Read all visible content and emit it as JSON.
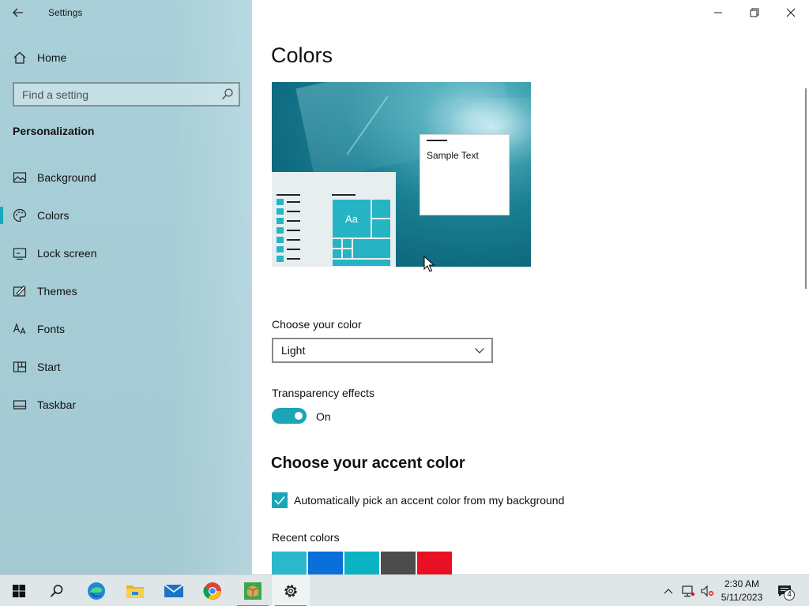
{
  "window": {
    "title": "Settings"
  },
  "sidebar": {
    "home_label": "Home",
    "search_placeholder": "Find a setting",
    "section_title": "Personalization",
    "items": [
      {
        "label": "Background",
        "icon": "image-icon"
      },
      {
        "label": "Colors",
        "icon": "palette-icon",
        "active": true
      },
      {
        "label": "Lock screen",
        "icon": "lock-screen-icon"
      },
      {
        "label": "Themes",
        "icon": "themes-icon"
      },
      {
        "label": "Fonts",
        "icon": "fonts-icon"
      },
      {
        "label": "Start",
        "icon": "start-icon"
      },
      {
        "label": "Taskbar",
        "icon": "taskbar-icon"
      }
    ]
  },
  "main": {
    "title": "Colors",
    "preview": {
      "tile_text": "Aa",
      "sample_text": "Sample Text"
    },
    "choose_color": {
      "label": "Choose your color",
      "value": "Light"
    },
    "transparency": {
      "label": "Transparency effects",
      "state": "On",
      "enabled": true
    },
    "accent": {
      "heading": "Choose your accent color",
      "auto_pick_label": "Automatically pick an accent color from my background",
      "auto_pick_checked": true,
      "recent_colors_label": "Recent colors",
      "recent_colors": [
        "#2bb8cc",
        "#0a6fd8",
        "#0ab3c2",
        "#4c4c4c",
        "#e81123"
      ]
    }
  },
  "taskbar": {
    "apps": [
      "start-button",
      "search-button",
      "edge-icon",
      "file-explorer-icon",
      "mail-icon",
      "chrome-icon",
      "package-app-icon",
      "settings-icon"
    ],
    "time": "2:30 AM",
    "date": "5/11/2023",
    "notification_count": "4"
  },
  "colors": {
    "accent": "#1ba5b8",
    "sidebar_bg": "#a9d0d9",
    "taskbar_bg": "#dfe6e8"
  }
}
